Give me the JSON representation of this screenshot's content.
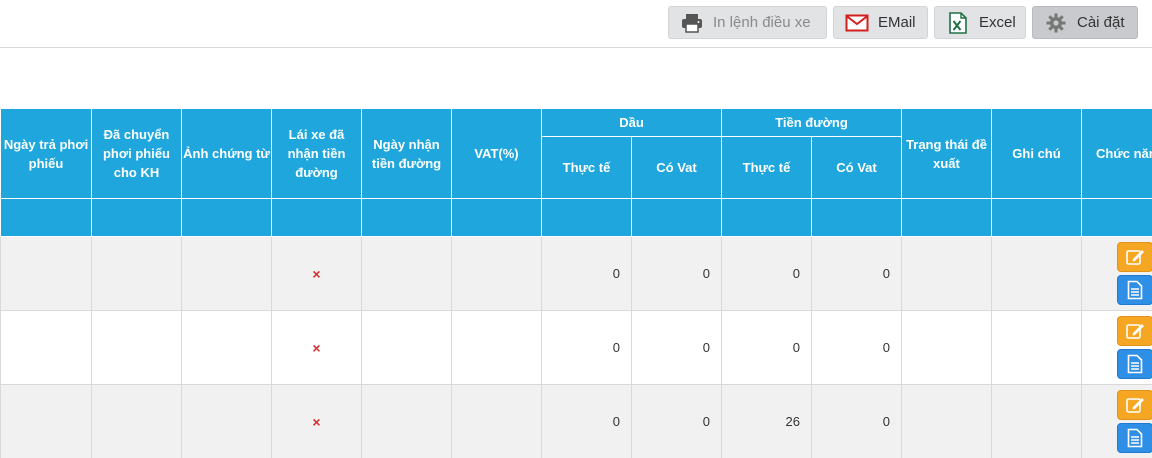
{
  "toolbar": {
    "print_label": "In lệnh điều xe",
    "print_icon": "printer-icon",
    "email_label": "EMail",
    "email_icon": "envelope-icon",
    "excel_label": "Excel",
    "excel_icon": "excel-icon",
    "settings_label": "Cài đặt",
    "settings_icon": "gear-icon"
  },
  "colors": {
    "header_bg": "#1fa7dd",
    "edit_button": "#f5a623",
    "doc_button": "#2f8fe6",
    "x_mark": "#d32f2f"
  },
  "table": {
    "headers": {
      "ngay_tra": "Ngày trả phơi phiếu",
      "da_chuyen": "Đã chuyển phơi phiếu cho KH",
      "anh_chung_tu": "Ảnh chứng từ",
      "lai_xe_nhan": "Lái xe đã nhận tiền đường",
      "ngay_nhan": "Ngày nhận tiền đường",
      "vat": "VAT(%)",
      "dau": "Dầu",
      "tien_duong": "Tiền đường",
      "thuc_te": "Thực tế",
      "co_vat": "Có Vat",
      "trang_thai": "Trạng thái đề xuất",
      "ghi_chu": "Ghi chú",
      "chuc_nang": "Chức năng"
    },
    "rows": [
      {
        "lai_xe_mark": "×",
        "dau_thuc_te": "0",
        "dau_co_vat": "0",
        "td_thuc_te": "0",
        "td_co_vat": "0"
      },
      {
        "lai_xe_mark": "×",
        "dau_thuc_te": "0",
        "dau_co_vat": "0",
        "td_thuc_te": "0",
        "td_co_vat": "0"
      },
      {
        "lai_xe_mark": "×",
        "dau_thuc_te": "0",
        "dau_co_vat": "0",
        "td_thuc_te": "26",
        "td_co_vat": "0"
      }
    ]
  }
}
